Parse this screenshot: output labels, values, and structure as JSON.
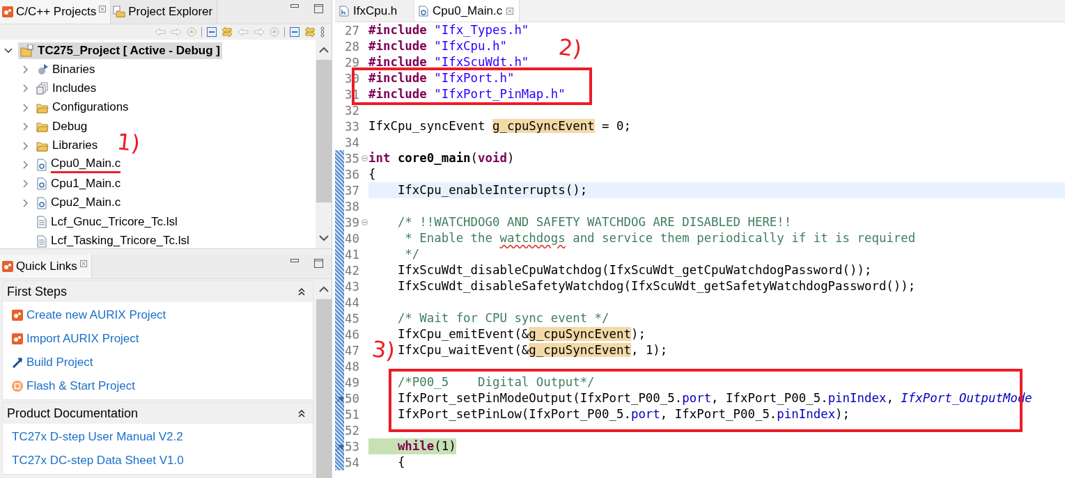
{
  "project_panel": {
    "tabs": [
      {
        "label": "C/C++ Projects",
        "selected": true
      },
      {
        "label": "Project Explorer",
        "selected": false
      }
    ],
    "tree": {
      "label": "TC275_Project [ Active - Debug ]",
      "selected": true,
      "expanded": true,
      "children": [
        {
          "label": "Binaries",
          "kind": "binaries",
          "expandable": true,
          "underlined": false
        },
        {
          "label": "Includes",
          "kind": "includes",
          "expandable": true,
          "underlined": false
        },
        {
          "label": "Configurations",
          "kind": "folder",
          "expandable": true,
          "underlined": false
        },
        {
          "label": "Debug",
          "kind": "folder",
          "expandable": true,
          "underlined": false
        },
        {
          "label": "Libraries",
          "kind": "folder",
          "expandable": true,
          "underlined": false
        },
        {
          "label": "Cpu0_Main.c",
          "kind": "c-file",
          "expandable": true,
          "underlined": true
        },
        {
          "label": "Cpu1_Main.c",
          "kind": "c-file",
          "expandable": true,
          "underlined": false
        },
        {
          "label": "Cpu2_Main.c",
          "kind": "c-file",
          "expandable": true,
          "underlined": false
        },
        {
          "label": "Lcf_Gnuc_Tricore_Tc.lsl",
          "kind": "text-file",
          "expandable": false,
          "underlined": false
        },
        {
          "label": "Lcf_Tasking_Tricore_Tc.lsl",
          "kind": "text-file",
          "expandable": false,
          "underlined": false
        }
      ]
    }
  },
  "quick_links": {
    "tab": {
      "label": "Quick Links",
      "selected": true
    },
    "sections": [
      {
        "title": "First Steps",
        "links": [
          {
            "label": "Create new AURIX Project",
            "kind": "aurix"
          },
          {
            "label": "Import AURIX Project",
            "kind": "aurix"
          },
          {
            "label": "Build Project",
            "kind": "hammer"
          },
          {
            "label": "Flash & Start Project",
            "kind": "chip"
          }
        ]
      },
      {
        "title": "Product Documentation",
        "links": [
          {
            "label": "TC27x D-step User Manual V2.2",
            "kind": "doc"
          },
          {
            "label": "TC27x DC-step Data Sheet V1.0",
            "kind": "doc"
          }
        ]
      }
    ]
  },
  "editor": {
    "tabs": [
      {
        "label": "IfxCpu.h",
        "kind": "h-file",
        "selected": false
      },
      {
        "label": "Cpu0_Main.c",
        "kind": "c-file",
        "selected": true
      }
    ],
    "lines": [
      {
        "number": "27",
        "tokens": [
          {
            "kind": "directive",
            "text": "#include "
          },
          {
            "kind": "string",
            "text": "\"Ifx_Types.h\""
          }
        ]
      },
      {
        "number": "28",
        "tokens": [
          {
            "kind": "directive",
            "text": "#include "
          },
          {
            "kind": "string",
            "text": "\"IfxCpu.h\""
          }
        ]
      },
      {
        "number": "29",
        "tokens": [
          {
            "kind": "directive",
            "text": "#include "
          },
          {
            "kind": "string",
            "text": "\"IfxScuWdt.h\""
          }
        ]
      },
      {
        "number": "30",
        "tokens": [
          {
            "kind": "directive",
            "text": "#include "
          },
          {
            "kind": "string",
            "text": "\"IfxPort.h\""
          }
        ]
      },
      {
        "number": "31",
        "tokens": [
          {
            "kind": "directive",
            "text": "#include "
          },
          {
            "kind": "string",
            "text": "\"IfxPort_PinMap.h\""
          }
        ]
      },
      {
        "number": "32"
      },
      {
        "number": "33",
        "tokens": [
          {
            "kind": "plain",
            "text": "IfxCpu_syncEvent "
          },
          {
            "kind": "occurrence",
            "text": "g_cpuSyncEvent"
          },
          {
            "kind": "plain",
            "text": " = 0;"
          }
        ]
      },
      {
        "number": "34"
      },
      {
        "number": "35",
        "fold": true,
        "changed": true,
        "tokens": [
          {
            "kind": "keyword",
            "text": "int "
          },
          {
            "kind": "declaration",
            "text": "core0_main"
          },
          {
            "kind": "plain",
            "text": "("
          },
          {
            "kind": "keyword",
            "text": "void"
          },
          {
            "kind": "plain",
            "text": ")"
          }
        ]
      },
      {
        "number": "36",
        "changed": true,
        "tokens": [
          {
            "kind": "plain",
            "text": "{"
          }
        ]
      },
      {
        "number": "37",
        "changed": true,
        "current_line": true,
        "tokens": [
          {
            "kind": "plain",
            "text": "    IfxCpu_enableInterrupts();"
          }
        ]
      },
      {
        "number": "38",
        "changed": true
      },
      {
        "number": "39",
        "fold": true,
        "changed": true,
        "tokens": [
          {
            "kind": "comment",
            "text": "    /* !!WATCHDOG0 AND SAFETY WATCHDOG ARE DISABLED HERE!!"
          }
        ]
      },
      {
        "number": "40",
        "changed": true,
        "tokens": [
          {
            "kind": "comment",
            "text": "     * Enable the "
          },
          {
            "kind": "misspelled",
            "text": "watchdogs"
          },
          {
            "kind": "comment",
            "text": " and service them periodically if it is required"
          }
        ]
      },
      {
        "number": "41",
        "changed": true,
        "tokens": [
          {
            "kind": "comment",
            "text": "     */"
          }
        ]
      },
      {
        "number": "42",
        "changed": true,
        "tokens": [
          {
            "kind": "plain",
            "text": "    IfxScuWdt_disableCpuWatchdog(IfxScuWdt_getCpuWatchdogPassword());"
          }
        ]
      },
      {
        "number": "43",
        "changed": true,
        "tokens": [
          {
            "kind": "plain",
            "text": "    IfxScuWdt_disableSafetyWatchdog(IfxScuWdt_getSafetyWatchdogPassword());"
          }
        ]
      },
      {
        "number": "44",
        "changed": true
      },
      {
        "number": "45",
        "changed": true,
        "tokens": [
          {
            "kind": "comment",
            "text": "    /* Wait for CPU sync event */"
          }
        ]
      },
      {
        "number": "46",
        "changed": true,
        "tokens": [
          {
            "kind": "plain",
            "text": "    IfxCpu_emitEvent(&"
          },
          {
            "kind": "occurrence",
            "text": "g_cpuSyncEvent"
          },
          {
            "kind": "plain",
            "text": ");"
          }
        ]
      },
      {
        "number": "47",
        "changed": true,
        "tokens": [
          {
            "kind": "plain",
            "text": "    IfxCpu_waitEvent(&"
          },
          {
            "kind": "occurrence",
            "text": "g_cpuSyncEvent"
          },
          {
            "kind": "plain",
            "text": ", 1);"
          }
        ]
      },
      {
        "number": "48",
        "changed": true
      },
      {
        "number": "49",
        "changed": true,
        "tokens": [
          {
            "kind": "comment",
            "text": "    /*P00_5    Digital Output*/"
          }
        ]
      },
      {
        "number": "50",
        "changed": true,
        "marker": true,
        "tokens": [
          {
            "kind": "plain",
            "text": "    IfxPort_setPinModeOutput(IfxPort_P00_5."
          },
          {
            "kind": "field",
            "text": "port"
          },
          {
            "kind": "plain",
            "text": ", IfxPort_P00_5."
          },
          {
            "kind": "field",
            "text": "pinIndex"
          },
          {
            "kind": "plain",
            "text": ", "
          },
          {
            "kind": "enum",
            "text": "IfxPort_OutputMode"
          }
        ]
      },
      {
        "number": "51",
        "changed": true,
        "tokens": [
          {
            "kind": "plain",
            "text": "    IfxPort_setPinLow(IfxPort_P00_5."
          },
          {
            "kind": "field",
            "text": "port"
          },
          {
            "kind": "plain",
            "text": ", IfxPort_P00_5."
          },
          {
            "kind": "field",
            "text": "pinIndex"
          },
          {
            "kind": "plain",
            "text": ");"
          }
        ]
      },
      {
        "number": "52",
        "changed": true
      },
      {
        "number": "53",
        "changed": true,
        "marker": true,
        "bracket_match": true,
        "tokens": [
          {
            "kind": "keyword",
            "text": "    while"
          },
          {
            "kind": "plain",
            "text": "(1)"
          }
        ]
      },
      {
        "number": "54",
        "changed": true,
        "tokens": [
          {
            "kind": "plain",
            "text": "    {"
          }
        ]
      }
    ]
  },
  "annotations": [
    {
      "kind": "note",
      "text": "2)"
    },
    {
      "kind": "box"
    },
    {
      "kind": "note",
      "text": "1)"
    },
    {
      "kind": "note",
      "text": "3)"
    },
    {
      "kind": "box"
    }
  ]
}
